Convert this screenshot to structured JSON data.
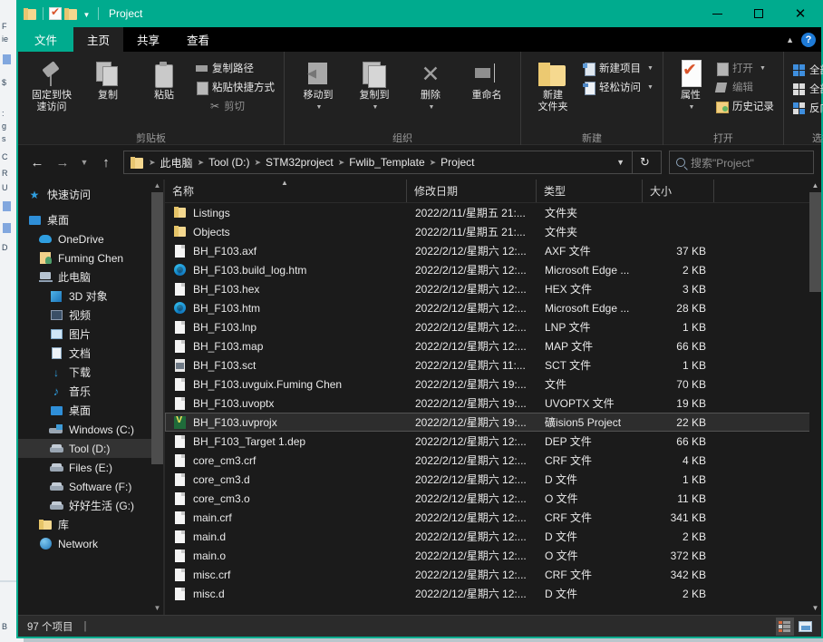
{
  "window": {
    "title": "Project",
    "quick_access_icons": [
      "folder-icon",
      "properties-icon",
      "new-folder-icon",
      "customize-caret-icon"
    ],
    "controls": {
      "minimize": "minimize-icon",
      "maximize": "maximize-icon",
      "close": "close-icon"
    }
  },
  "ribbon": {
    "tabs": [
      {
        "label": "文件",
        "kind": "file"
      },
      {
        "label": "主页",
        "kind": "active"
      },
      {
        "label": "共享",
        "kind": "normal"
      },
      {
        "label": "查看",
        "kind": "normal"
      }
    ],
    "collapse_icon": "chevron-up-icon",
    "help_label": "?",
    "groups": [
      {
        "label": "剪贴板",
        "big": [
          {
            "label": "固定到快\n速访问",
            "line1": "固定到快",
            "line2": "速访问",
            "icon": "pin-icon"
          },
          {
            "label": "复制",
            "line1": "复制",
            "line2": "",
            "icon": "copy-icon"
          },
          {
            "label": "粘贴",
            "line1": "粘贴",
            "line2": "",
            "icon": "paste-icon"
          }
        ],
        "small": [
          {
            "label": "复制路径",
            "icon": "copy-path-icon"
          },
          {
            "label": "粘贴快捷方式",
            "icon": "paste-shortcut-icon"
          },
          {
            "label": "剪切",
            "icon": "scissors-icon"
          }
        ]
      },
      {
        "label": "组织",
        "big": [
          {
            "line1": "移动到",
            "line2": "",
            "icon": "move-to-icon",
            "caret": true
          },
          {
            "line1": "复制到",
            "line2": "",
            "icon": "copy-to-icon",
            "caret": true
          },
          {
            "line1": "删除",
            "line2": "",
            "icon": "delete-icon",
            "caret": true
          },
          {
            "line1": "重命名",
            "line2": "",
            "icon": "rename-icon",
            "caret": false
          }
        ],
        "small": []
      },
      {
        "label": "新建",
        "big": [
          {
            "line1": "新建",
            "line2": "文件夹",
            "icon": "new-folder-icon"
          }
        ],
        "small": [
          {
            "label": "新建项目",
            "icon": "new-item-icon",
            "caret": true
          },
          {
            "label": "轻松访问",
            "icon": "easy-access-icon",
            "caret": true
          }
        ]
      },
      {
        "label": "打开",
        "big": [
          {
            "line1": "属性",
            "line2": "",
            "icon": "properties-icon",
            "caret": true
          }
        ],
        "small": [
          {
            "label": "打开",
            "icon": "open-icon",
            "caret": true
          },
          {
            "label": "编辑",
            "icon": "edit-icon"
          },
          {
            "label": "历史记录",
            "icon": "history-icon"
          }
        ]
      },
      {
        "label": "选择",
        "big": [],
        "small": [
          {
            "label": "全部选择",
            "icon": "select-all-icon"
          },
          {
            "label": "全部取消",
            "icon": "select-none-icon"
          },
          {
            "label": "反向选择",
            "icon": "invert-selection-icon"
          }
        ]
      }
    ]
  },
  "address": {
    "back_icon": "back-arrow-icon",
    "forward_icon": "forward-arrow-icon",
    "recent_icon": "recent-locations-caret-icon",
    "up_icon": "up-arrow-icon",
    "folder_icon": "folder-icon",
    "crumbs": [
      "此电脑",
      "Tool (D:)",
      "STM32project",
      "Fwlib_Template",
      "Project"
    ],
    "dropdown_icon": "chevron-down-icon",
    "refresh_icon": "refresh-icon",
    "search_placeholder": "搜索\"Project\"",
    "search_value": ""
  },
  "sidebar": {
    "items": [
      {
        "label": "快速访问",
        "icon": "star-icon",
        "level": 0,
        "selected": false,
        "gap_after": true
      },
      {
        "label": "桌面",
        "icon": "desktop-icon",
        "level": 0,
        "selected": false
      },
      {
        "label": "OneDrive",
        "icon": "cloud-icon",
        "level": 1,
        "selected": false
      },
      {
        "label": "Fuming Chen",
        "icon": "user-icon",
        "level": 1,
        "selected": false
      },
      {
        "label": "此电脑",
        "icon": "this-pc-icon",
        "level": 1,
        "selected": false
      },
      {
        "label": "3D 对象",
        "icon": "3d-objects-icon",
        "level": 2,
        "selected": false
      },
      {
        "label": "视频",
        "icon": "videos-icon",
        "level": 2,
        "selected": false
      },
      {
        "label": "图片",
        "icon": "pictures-icon",
        "level": 2,
        "selected": false
      },
      {
        "label": "文档",
        "icon": "documents-icon",
        "level": 2,
        "selected": false
      },
      {
        "label": "下载",
        "icon": "downloads-icon",
        "level": 2,
        "selected": false
      },
      {
        "label": "音乐",
        "icon": "music-icon",
        "level": 2,
        "selected": false
      },
      {
        "label": "桌面",
        "icon": "desktop-icon",
        "level": 2,
        "selected": false
      },
      {
        "label": "Windows (C:)",
        "icon": "windows-drive-icon",
        "level": 2,
        "selected": false
      },
      {
        "label": "Tool (D:)",
        "icon": "drive-icon",
        "level": 2,
        "selected": true
      },
      {
        "label": "Files (E:)",
        "icon": "drive-icon",
        "level": 2,
        "selected": false
      },
      {
        "label": "Software (F:)",
        "icon": "drive-icon",
        "level": 2,
        "selected": false
      },
      {
        "label": "好好生活 (G:)",
        "icon": "drive-icon",
        "level": 2,
        "selected": false
      },
      {
        "label": "库",
        "icon": "library-icon",
        "level": 1,
        "selected": false
      },
      {
        "label": "Network",
        "icon": "network-icon",
        "level": 1,
        "selected": false
      }
    ],
    "scroll_up_icon": "scroll-up-icon",
    "scroll_down_icon": "scroll-down-icon"
  },
  "filelist": {
    "columns": [
      "名称",
      "修改日期",
      "类型",
      "大小"
    ],
    "sort_indicator": "ascending-caret-icon",
    "rows": [
      {
        "name": "Listings",
        "date": "2022/2/11/星期五 21:...",
        "type": "文件夹",
        "size": "",
        "icon": "folder-icon",
        "selected": false
      },
      {
        "name": "Objects",
        "date": "2022/2/11/星期五 21:...",
        "type": "文件夹",
        "size": "",
        "icon": "folder-icon",
        "selected": false
      },
      {
        "name": "BH_F103.axf",
        "date": "2022/2/12/星期六 12:...",
        "type": "AXF 文件",
        "size": "37 KB",
        "icon": "generic-file-icon",
        "selected": false
      },
      {
        "name": "BH_F103.build_log.htm",
        "date": "2022/2/12/星期六 12:...",
        "type": "Microsoft Edge ...",
        "size": "2 KB",
        "icon": "edge-icon",
        "selected": false
      },
      {
        "name": "BH_F103.hex",
        "date": "2022/2/12/星期六 12:...",
        "type": "HEX 文件",
        "size": "3 KB",
        "icon": "generic-file-icon",
        "selected": false
      },
      {
        "name": "BH_F103.htm",
        "date": "2022/2/12/星期六 12:...",
        "type": "Microsoft Edge ...",
        "size": "28 KB",
        "icon": "edge-icon",
        "selected": false
      },
      {
        "name": "BH_F103.lnp",
        "date": "2022/2/12/星期六 12:...",
        "type": "LNP 文件",
        "size": "1 KB",
        "icon": "generic-file-icon",
        "selected": false
      },
      {
        "name": "BH_F103.map",
        "date": "2022/2/12/星期六 12:...",
        "type": "MAP 文件",
        "size": "66 KB",
        "icon": "generic-file-icon",
        "selected": false
      },
      {
        "name": "BH_F103.sct",
        "date": "2022/2/12/星期六 11:...",
        "type": "SCT 文件",
        "size": "1 KB",
        "icon": "sct-file-icon",
        "selected": false
      },
      {
        "name": "BH_F103.uvguix.Fuming Chen",
        "date": "2022/2/12/星期六 19:...",
        "type": "文件",
        "size": "70 KB",
        "icon": "generic-file-icon",
        "selected": false
      },
      {
        "name": "BH_F103.uvoptx",
        "date": "2022/2/12/星期六 19:...",
        "type": "UVOPTX 文件",
        "size": "19 KB",
        "icon": "generic-file-icon",
        "selected": false
      },
      {
        "name": "BH_F103.uvprojx",
        "date": "2022/2/12/星期六 19:...",
        "type": "礦ision5 Project",
        "size": "22 KB",
        "icon": "keil-project-icon",
        "selected": true
      },
      {
        "name": "BH_F103_Target 1.dep",
        "date": "2022/2/12/星期六 12:...",
        "type": "DEP 文件",
        "size": "66 KB",
        "icon": "generic-file-icon",
        "selected": false
      },
      {
        "name": "core_cm3.crf",
        "date": "2022/2/12/星期六 12:...",
        "type": "CRF 文件",
        "size": "4 KB",
        "icon": "generic-file-icon",
        "selected": false
      },
      {
        "name": "core_cm3.d",
        "date": "2022/2/12/星期六 12:...",
        "type": "D 文件",
        "size": "1 KB",
        "icon": "generic-file-icon",
        "selected": false
      },
      {
        "name": "core_cm3.o",
        "date": "2022/2/12/星期六 12:...",
        "type": "O 文件",
        "size": "11 KB",
        "icon": "generic-file-icon",
        "selected": false
      },
      {
        "name": "main.crf",
        "date": "2022/2/12/星期六 12:...",
        "type": "CRF 文件",
        "size": "341 KB",
        "icon": "generic-file-icon",
        "selected": false
      },
      {
        "name": "main.d",
        "date": "2022/2/12/星期六 12:...",
        "type": "D 文件",
        "size": "2 KB",
        "icon": "generic-file-icon",
        "selected": false
      },
      {
        "name": "main.o",
        "date": "2022/2/12/星期六 12:...",
        "type": "O 文件",
        "size": "372 KB",
        "icon": "generic-file-icon",
        "selected": false
      },
      {
        "name": "misc.crf",
        "date": "2022/2/12/星期六 12:...",
        "type": "CRF 文件",
        "size": "342 KB",
        "icon": "generic-file-icon",
        "selected": false
      },
      {
        "name": "misc.d",
        "date": "2022/2/12/星期六 12:...",
        "type": "D 文件",
        "size": "2 KB",
        "icon": "generic-file-icon",
        "selected": false
      }
    ]
  },
  "status": {
    "item_count": "97 个项目",
    "separator": "|",
    "view_details_icon": "details-view-icon",
    "view_large_icon": "large-icons-view-icon"
  },
  "colors": {
    "accent": "#00ab8e",
    "window_bg": "#1b1b1b",
    "ribbon_bg": "#212121",
    "selection": "#2d2d2d"
  }
}
